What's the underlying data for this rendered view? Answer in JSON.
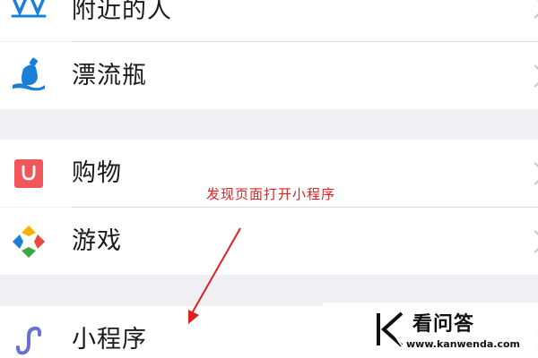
{
  "menu": {
    "items": [
      {
        "label": "附近的人",
        "icon": "people-nearby-icon"
      },
      {
        "label": "漂流瓶",
        "icon": "drift-bottle-icon"
      },
      {
        "label": "购物",
        "icon": "shopping-icon"
      },
      {
        "label": "游戏",
        "icon": "games-icon"
      },
      {
        "label": "小程序",
        "icon": "mini-program-icon"
      }
    ]
  },
  "annotation": {
    "text": "发现页面打开小程序",
    "color": "#e02020"
  },
  "watermark": {
    "title": "看问答",
    "url": "www.kanwenda.com"
  },
  "colors": {
    "background": "#efeff4",
    "row": "#ffffff",
    "shopping_red": "#f0565a",
    "drift_blue": "#1a7fd6",
    "mini_program_purple": "#6a6fd8"
  }
}
